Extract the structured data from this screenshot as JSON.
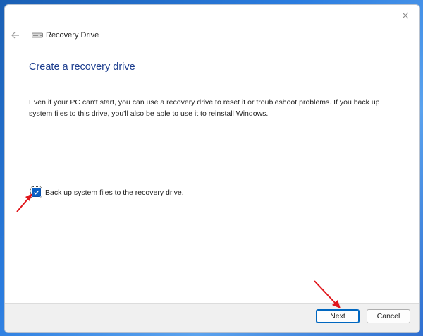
{
  "window": {
    "title": "Recovery Drive",
    "close_icon": "close-icon",
    "back_icon": "back-arrow-icon",
    "app_icon": "drive-icon"
  },
  "page": {
    "heading": "Create a recovery drive",
    "description": "Even if your PC can't start, you can use a recovery drive to reset it or troubleshoot problems. If you back up system files to this drive, you'll also be able to use it to reinstall Windows."
  },
  "options": {
    "backup_checkbox": {
      "label": "Back up system files to the recovery drive.",
      "checked": true
    }
  },
  "footer": {
    "next_label": "Next",
    "cancel_label": "Cancel"
  },
  "colors": {
    "accent": "#0067c0",
    "heading": "#1e3f8f",
    "annotation_arrow": "#e0161b"
  }
}
